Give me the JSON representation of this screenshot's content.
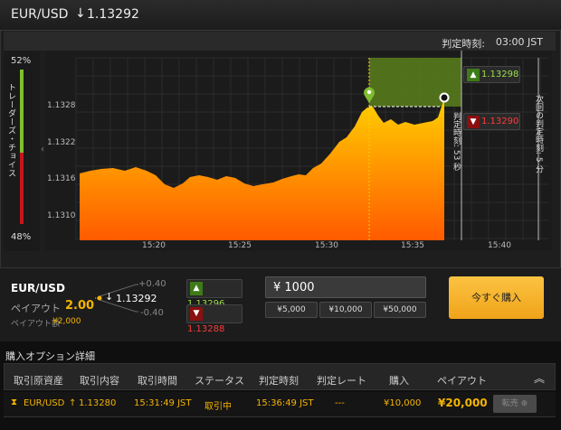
{
  "header": {
    "pair": "EUR/USD",
    "direction_icon": "arrow-down-icon",
    "arrow": "↓",
    "price": "1.13292"
  },
  "judgement": {
    "label": "判定時刻:",
    "time": "03:00 JST"
  },
  "traders": {
    "label": "トレーダーズ・チョイス",
    "high_pct": "52%",
    "low_pct": "48%",
    "high_fraction": 0.52,
    "low_fraction": 0.48,
    "colors": {
      "high": "#7fbf2f",
      "low": "#c4161c"
    }
  },
  "chart": {
    "y_ticks": [
      "1.1328",
      "1.1322",
      "1.1316",
      "1.1310"
    ],
    "x_ticks": [
      "15:20",
      "15:25",
      "15:30",
      "15:35",
      "15:40"
    ],
    "up_price": "1.13298",
    "down_price": "1.13290",
    "judge_remaining": "判定時刻: 53 秒",
    "next_judge": "次回の判定時刻: 5 分",
    "colors": {
      "area_top": "#ffd000",
      "area_bottom": "#ff5a00",
      "target_box": "#5b7f1c"
    }
  },
  "trade": {
    "pair": "EUR/USD",
    "payout_label": "ペイアウト",
    "payout_value": "2.00",
    "payout_amount_label": "ペイアウト額",
    "payout_amount": "¥2,000",
    "offset_plus": "+0.40",
    "offset_minus": "-0.40",
    "current_arrow": "↓",
    "current_price": "1.13292",
    "up_price": "1.13296",
    "down_price": "1.13288",
    "amount": "¥ 1000",
    "presets": [
      "¥5,000",
      "¥10,000",
      "¥50,000"
    ],
    "buy_label": "今すぐ購入"
  },
  "details": {
    "title": "購入オプション詳細",
    "columns": [
      "取引原資産",
      "取引内容",
      "取引時間",
      "ステータス",
      "判定時刻",
      "判定レート",
      "購入",
      "ペイアウト"
    ],
    "row": {
      "asset": "EUR/USD",
      "content_arrow": "↑",
      "content": "1.13280",
      "trade_time": "15:31:49 JST",
      "status": "取引中",
      "judge_time": "15:36:49 JST",
      "judge_rate": "---",
      "purchase": "¥10,000",
      "payout": "¥20,000",
      "sell_label": "転売"
    }
  }
}
